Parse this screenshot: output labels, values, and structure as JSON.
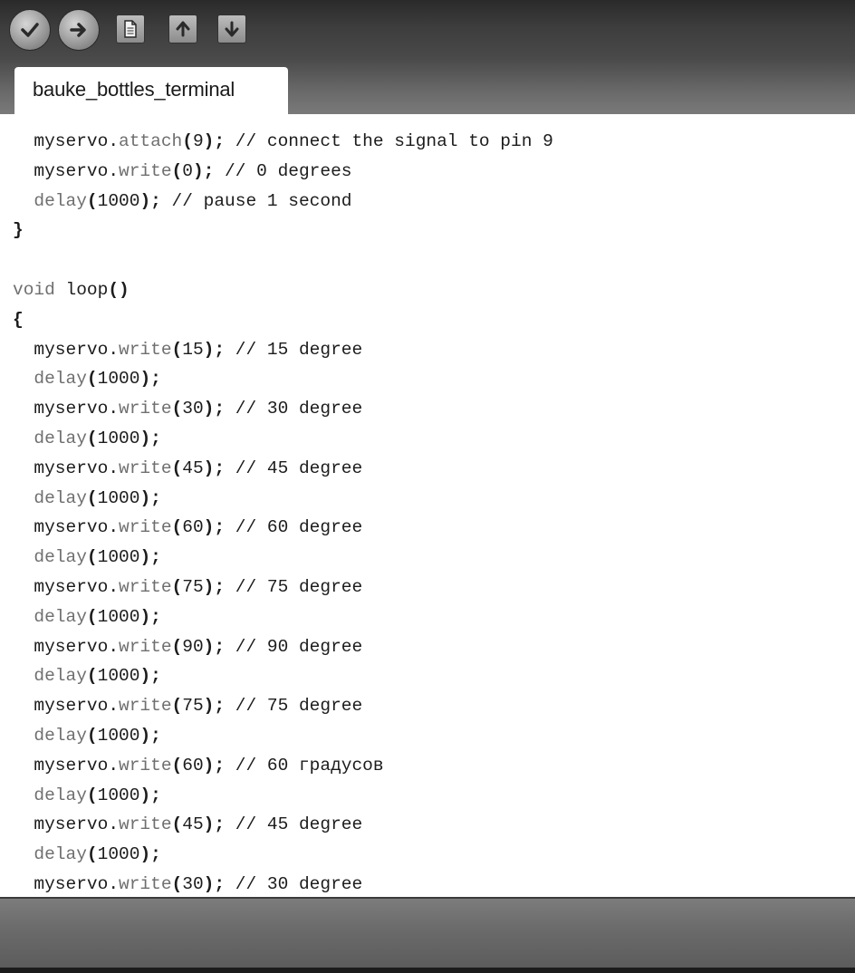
{
  "toolbar": {
    "buttons": [
      {
        "name": "verify-button",
        "icon": "check-icon"
      },
      {
        "name": "upload-button",
        "icon": "arrow-right-icon"
      },
      {
        "name": "new-button",
        "icon": "new-file-icon"
      },
      {
        "name": "open-button",
        "icon": "arrow-up-icon"
      },
      {
        "name": "save-button",
        "icon": "arrow-down-icon"
      }
    ]
  },
  "tabs": [
    {
      "label": "bauke_bottles_terminal",
      "active": true
    }
  ],
  "code": {
    "lines": [
      "  myservo.attach(9); // connect the signal to pin 9",
      "  myservo.write(0); // 0 degrees",
      "  delay(1000); // pause 1 second",
      "}",
      "",
      "void loop()",
      "{",
      "  myservo.write(15); // 15 degree",
      "  delay(1000);",
      "  myservo.write(30); // 30 degree",
      "  delay(1000);",
      "  myservo.write(45); // 45 degree",
      "  delay(1000);",
      "  myservo.write(60); // 60 degree",
      "  delay(1000);",
      "  myservo.write(75); // 75 degree",
      "  delay(1000);",
      "  myservo.write(90); // 90 degree",
      "  delay(1000);",
      "  myservo.write(75); // 75 degree",
      "  delay(1000);",
      "  myservo.write(60); // 60 градусов",
      "  delay(1000);",
      "  myservo.write(45); // 45 degree",
      "  delay(1000);",
      "  myservo.write(30); // 30 degree"
    ]
  }
}
